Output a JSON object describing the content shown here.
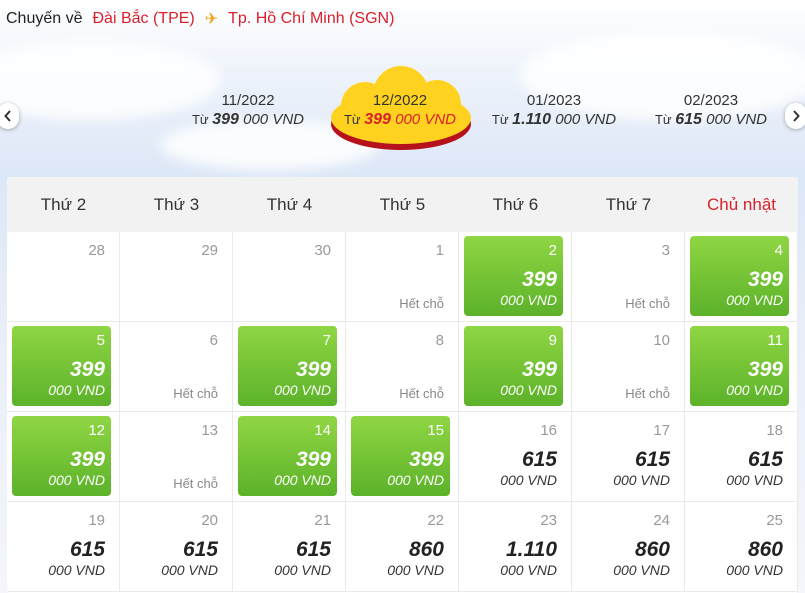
{
  "route": {
    "label": "Chuyến về",
    "origin": "Đài Bắc (TPE)",
    "destination": "Tp. Hồ Chí Minh (SGN)",
    "plane_icon": "plane-icon"
  },
  "months": [
    {
      "label": "11/2022",
      "from": "Từ",
      "price": "399",
      "unit": "000 VND",
      "active": false
    },
    {
      "label": "12/2022",
      "from": "Từ",
      "price": "399",
      "unit": "000 VND",
      "active": true
    },
    {
      "label": "01/2023",
      "from": "Từ",
      "price": "1.110",
      "unit": "000 VND",
      "active": false
    },
    {
      "label": "02/2023",
      "from": "Từ",
      "price": "615",
      "unit": "000 VND",
      "active": false
    }
  ],
  "colors": {
    "accent_red": "#d8212b",
    "green_top": "#8fd643",
    "green_bottom": "#5cb22a",
    "cloud_yellow": "#ffd21f"
  },
  "weekdays": [
    "Thứ 2",
    "Thứ 3",
    "Thứ 4",
    "Thứ 5",
    "Thứ 6",
    "Thứ 7",
    "Chủ nhật"
  ],
  "weeks": [
    [
      {
        "day": "28",
        "type": "prev"
      },
      {
        "day": "29",
        "type": "prev"
      },
      {
        "day": "30",
        "type": "prev"
      },
      {
        "day": "1",
        "type": "soldout",
        "text": "Hết chỗ"
      },
      {
        "day": "2",
        "type": "green",
        "price": "399",
        "unit": "000 VND"
      },
      {
        "day": "3",
        "type": "soldout",
        "text": "Hết chỗ"
      },
      {
        "day": "4",
        "type": "green",
        "price": "399",
        "unit": "000 VND"
      }
    ],
    [
      {
        "day": "5",
        "type": "green",
        "price": "399",
        "unit": "000 VND"
      },
      {
        "day": "6",
        "type": "soldout",
        "text": "Hết chỗ"
      },
      {
        "day": "7",
        "type": "green",
        "price": "399",
        "unit": "000 VND"
      },
      {
        "day": "8",
        "type": "soldout",
        "text": "Hết chỗ"
      },
      {
        "day": "9",
        "type": "green",
        "price": "399",
        "unit": "000 VND"
      },
      {
        "day": "10",
        "type": "soldout",
        "text": "Hết chỗ"
      },
      {
        "day": "11",
        "type": "green",
        "price": "399",
        "unit": "000 VND"
      }
    ],
    [
      {
        "day": "12",
        "type": "green",
        "price": "399",
        "unit": "000 VND"
      },
      {
        "day": "13",
        "type": "soldout",
        "text": "Hết chỗ"
      },
      {
        "day": "14",
        "type": "green",
        "price": "399",
        "unit": "000 VND"
      },
      {
        "day": "15",
        "type": "green",
        "price": "399",
        "unit": "000 VND"
      },
      {
        "day": "16",
        "type": "price",
        "price": "615",
        "unit": "000 VND"
      },
      {
        "day": "17",
        "type": "price",
        "price": "615",
        "unit": "000 VND"
      },
      {
        "day": "18",
        "type": "price",
        "price": "615",
        "unit": "000 VND"
      }
    ],
    [
      {
        "day": "19",
        "type": "price",
        "price": "615",
        "unit": "000 VND"
      },
      {
        "day": "20",
        "type": "price",
        "price": "615",
        "unit": "000 VND"
      },
      {
        "day": "21",
        "type": "price",
        "price": "615",
        "unit": "000 VND"
      },
      {
        "day": "22",
        "type": "price",
        "price": "860",
        "unit": "000 VND"
      },
      {
        "day": "23",
        "type": "price",
        "price": "1.110",
        "unit": "000 VND"
      },
      {
        "day": "24",
        "type": "price",
        "price": "860",
        "unit": "000 VND"
      },
      {
        "day": "25",
        "type": "price",
        "price": "860",
        "unit": "000 VND"
      }
    ]
  ]
}
